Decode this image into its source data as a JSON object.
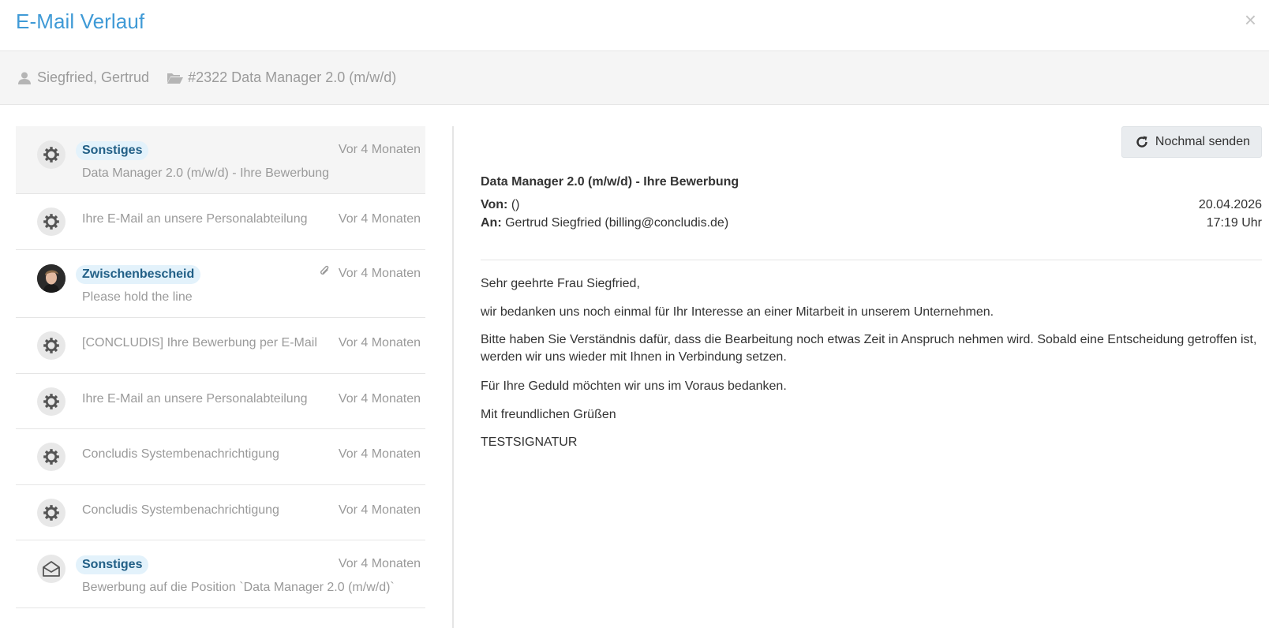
{
  "modal": {
    "title": "E-Mail Verlauf",
    "close": "×"
  },
  "context": {
    "candidate": "Siegfried, Gertrud",
    "job": "#2322 Data Manager 2.0 (m/w/d)"
  },
  "mails": [
    {
      "tag": "Sonstiges",
      "subject": "Data Manager 2.0 (m/w/d) - Ihre Bewerbung",
      "time": "Vor 4 Monaten",
      "icon": "gear-icon",
      "selected": true
    },
    {
      "tag": "",
      "subject": "Ihre E-Mail an unsere Personalabteilung",
      "time": "Vor 4 Monaten",
      "icon": "gear-icon"
    },
    {
      "tag": "Zwischenbescheid",
      "subject": "Please hold the line",
      "time": "Vor 4 Monaten",
      "icon": "user-photo",
      "attachment": true
    },
    {
      "tag": "",
      "subject": "[CONCLUDIS] Ihre Bewerbung per E-Mail",
      "time": "Vor 4 Monaten",
      "icon": "gear-icon"
    },
    {
      "tag": "",
      "subject": "Ihre E-Mail an unsere Personalabteilung",
      "time": "Vor 4 Monaten",
      "icon": "gear-icon"
    },
    {
      "tag": "",
      "subject": "Concludis Systembenachrichtigung",
      "time": "Vor 4 Monaten",
      "icon": "gear-icon"
    },
    {
      "tag": "",
      "subject": "Concludis Systembenachrichtigung",
      "time": "Vor 4 Monaten",
      "icon": "gear-icon"
    },
    {
      "tag": "Sonstiges",
      "subject": "Bewerbung auf die Position `Data Manager 2.0 (m/w/d)`",
      "time": "Vor 4 Monaten",
      "icon": "envelope-open-icon"
    }
  ],
  "detail": {
    "resend_label": "Nochmal senden",
    "subject": "Data Manager 2.0 (m/w/d) - Ihre Bewerbung",
    "from_label": "Von:",
    "from_value": "()",
    "to_label": "An:",
    "to_value": "Gertrud Siegfried (billing@concludis.de)",
    "date": "20.04.2026",
    "time": "17:19 Uhr",
    "body": [
      "Sehr geehrte Frau Siegfried,",
      "wir bedanken uns noch einmal für Ihr Interesse an einer Mitarbeit in unserem Unternehmen.",
      "Bitte haben Sie Verständnis dafür, dass die Bearbeitung noch etwas Zeit in Anspruch nehmen wird. Sobald eine Entscheidung getroffen ist, werden wir uns wieder mit Ihnen in Verbindung setzen.",
      "Für Ihre Geduld möchten wir uns im Voraus bedanken.",
      "Mit freundlichen Grüßen",
      "TESTSIGNATUR"
    ]
  }
}
